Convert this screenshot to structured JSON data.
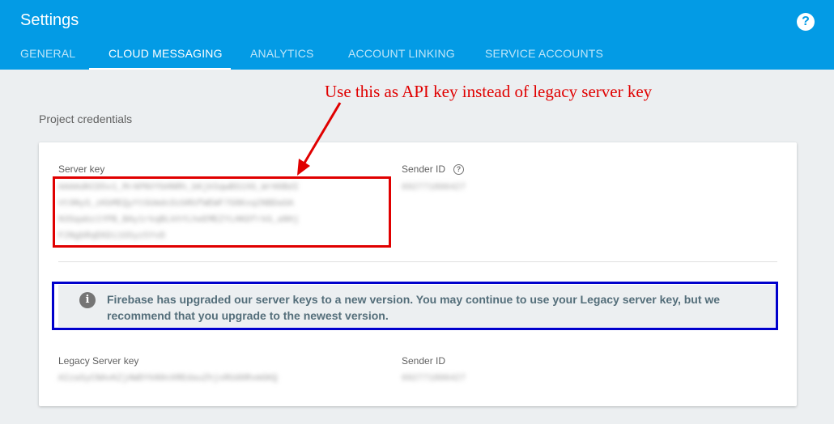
{
  "header": {
    "title": "Settings",
    "help_icon": "?"
  },
  "tabs": [
    {
      "label": "GENERAL",
      "active": false
    },
    {
      "label": "CLOUD MESSAGING",
      "active": true
    },
    {
      "label": "ANALYTICS",
      "active": false
    },
    {
      "label": "ACCOUNT LINKING",
      "active": false
    },
    {
      "label": "SERVICE ACCOUNTS",
      "active": false
    }
  ],
  "section": {
    "label": "Project credentials"
  },
  "credentials": {
    "server_key_label": "Server key",
    "server_key_value": "AAAAdKCD5v1_MrAPNVYbHNRh_bKjk5qwBS1XG_WrH0BdI\nVt9NyS_zKbMEQyYtGUmdcDzbRUfWEWF7G8Kxq2NBDaGA\nN3Sqabz1YPB_BAy1rkqBLkhYLheEMEZYLHKDfrkG_aNHj\nF2NgbRqEKDi1G5yz5YvD",
    "sender_id_label": "Sender ID",
    "sender_id_help": "?",
    "sender_id_value": "692771806427",
    "info_icon": "i",
    "info_text": "Firebase has upgraded our server keys to a new version. You may continue to use your Legacy server key, but we recommend that you upgrade to the newest version.",
    "legacy_key_label": "Legacy Server key",
    "legacy_key_value": "AIzaSyCNAvKZjAWDYkN9nXREdauZhjsRUd0RvmGKQ",
    "legacy_sender_id_label": "Sender ID",
    "legacy_sender_id_value": "692771806427"
  },
  "annotation": {
    "text": "Use this as API key instead of legacy server key",
    "color": "#e00000"
  },
  "colors": {
    "header": "#039be5",
    "background": "#eceff1",
    "highlight_red": "#e00000",
    "highlight_blue": "#0000cc"
  }
}
